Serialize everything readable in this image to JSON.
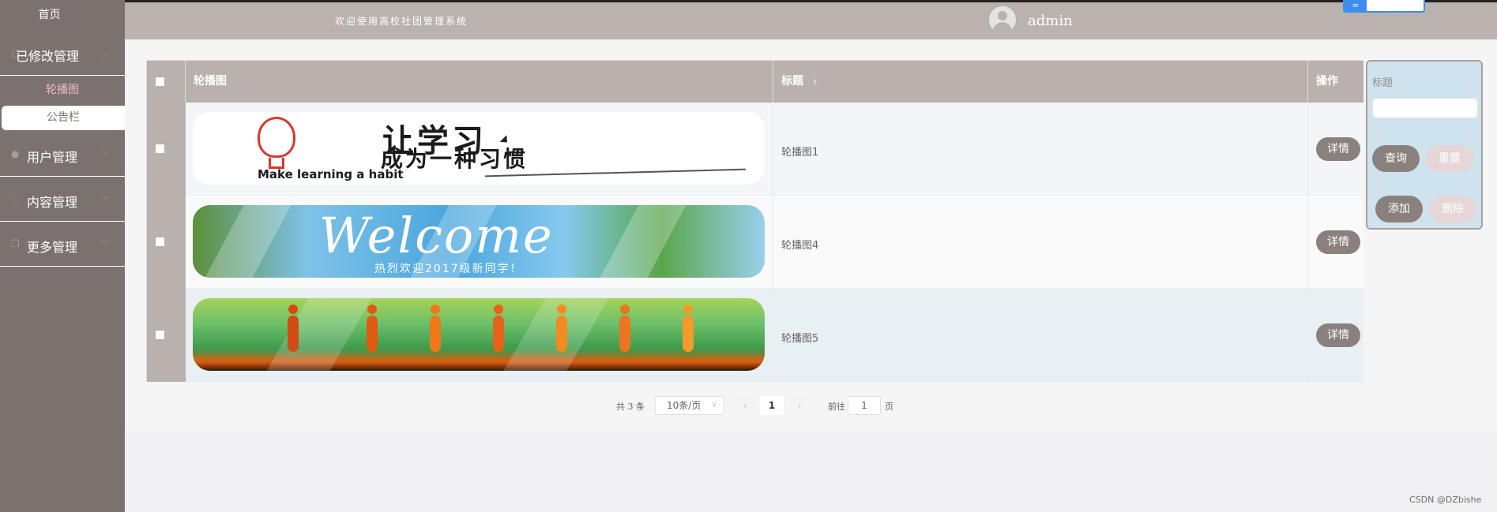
{
  "sidebar": {
    "home": "首页",
    "groups": [
      {
        "label": "已修改",
        "suffix": "管理",
        "icon": "square-icon"
      },
      {
        "label": "用户管理",
        "icon": "user-icon"
      },
      {
        "label": "内容管理",
        "icon": "chat-icon"
      },
      {
        "label": "更多管理",
        "icon": "copy-icon"
      }
    ],
    "sub_items": [
      {
        "label": "轮播图",
        "state": "active"
      },
      {
        "label": "公告栏",
        "state": "selected"
      }
    ]
  },
  "header": {
    "welcome": "欢迎使用高校社团管理系统",
    "username": "admin"
  },
  "table": {
    "columns": {
      "image": "轮播图",
      "title": "标题",
      "ops": "操作"
    },
    "rows": [
      {
        "title": "轮播图1",
        "detail": "详情",
        "banner": {
          "line1": "让学习",
          "line2": "成为一种习惯",
          "line3": "Make learning a habit"
        }
      },
      {
        "title": "轮播图4",
        "detail": "详情",
        "banner": {
          "line1": "Welcome",
          "line2": "热烈欢迎2017级新同学！"
        }
      },
      {
        "title": "轮播图5",
        "detail": "详情",
        "banner": {}
      }
    ]
  },
  "pagination": {
    "total": "共 3 条",
    "page_size": "10条/页",
    "current": "1",
    "goto_label": "前往",
    "goto_value": "1",
    "page_suffix": "页",
    "prev": "‹",
    "next": "›"
  },
  "search": {
    "label": "标题",
    "query": "查询",
    "reset": "重置",
    "add": "添加",
    "delete": "删除"
  },
  "watermark": "CSDN @DZbishe",
  "colors": {
    "sidebar": "#7b726f",
    "header": "#bab2af",
    "accent_pink": "#f2b8c6",
    "button": "#8a817e",
    "button_light": "#e7d6d6",
    "search_panel": "#cfe3ee"
  }
}
